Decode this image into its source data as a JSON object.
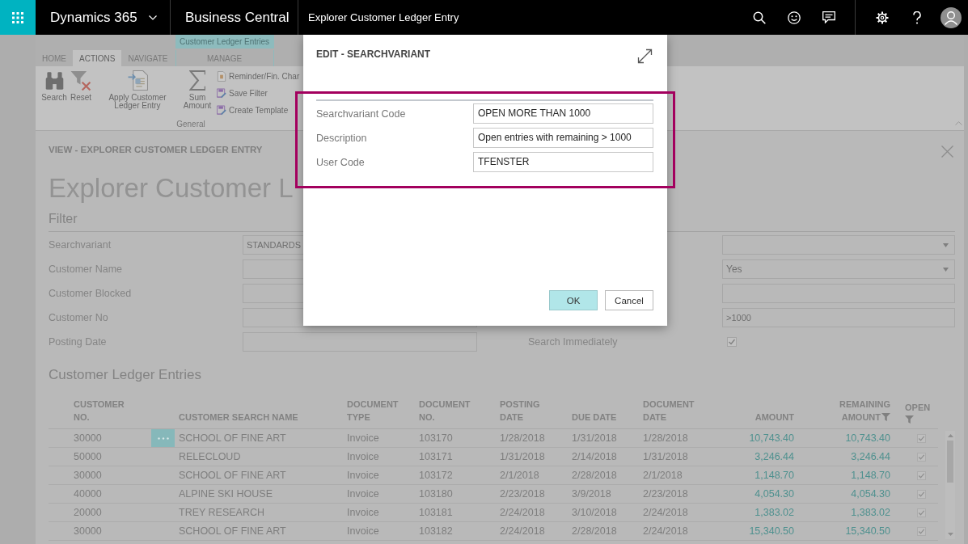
{
  "top_bar": {
    "app_name": "Dynamics 365",
    "product": "Business Central",
    "page_title": "Explorer Customer Ledger Entry"
  },
  "ribbon": {
    "contextual_label": "Customer Ledger Entries",
    "tabs": [
      {
        "label": "HOME",
        "selected": false,
        "contextual": false
      },
      {
        "label": "ACTIONS",
        "selected": true,
        "contextual": false
      },
      {
        "label": "NAVIGATE",
        "selected": false,
        "contextual": false
      },
      {
        "label": "MANAGE",
        "selected": false,
        "contextual": true
      }
    ],
    "actions": [
      {
        "label": "Search",
        "kind": "large"
      },
      {
        "label": "Reset",
        "kind": "large"
      },
      {
        "label": "Apply Customer Ledger Entry",
        "kind": "large"
      },
      {
        "label": "Sum Amount",
        "kind": "large"
      },
      {
        "label": "Reminder/Fin. Char",
        "kind": "small"
      },
      {
        "label": "Save Filter",
        "kind": "small"
      },
      {
        "label": "Create Template",
        "kind": "small"
      }
    ],
    "group_label": "General"
  },
  "page": {
    "caption": "VIEW - EXPLORER CUSTOMER LEDGER ENTRY",
    "title": "Explorer Customer L"
  },
  "filter": {
    "title": "Filter",
    "rows": [
      {
        "label": "Searchvariant",
        "value": "STANDARDS",
        "right_field": {
          "kind": "dropdown"
        }
      },
      {
        "label": "Customer Name",
        "right_field": {
          "kind": "dropdown",
          "value": "Yes"
        }
      },
      {
        "label": "Customer Blocked",
        "right_field": {
          "kind": "text"
        }
      },
      {
        "label": "Customer No",
        "right_field": {
          "kind": "text",
          "value": ">1000"
        }
      },
      {
        "label": "Posting Date",
        "right_field": {
          "kind": "checkbox",
          "label": "Search Immediately",
          "checked": true
        }
      }
    ]
  },
  "entries": {
    "title": "Customer Ledger Entries",
    "columns": [
      {
        "label": "CUSTOMER NO.",
        "kind": "text",
        "filtered": false
      },
      {
        "label": "CUSTOMER SEARCH NAME",
        "kind": "text",
        "filtered": false
      },
      {
        "label": "DOCUMENT TYPE",
        "kind": "text",
        "filtered": false
      },
      {
        "label": "DOCUMENT NO.",
        "kind": "text",
        "filtered": false
      },
      {
        "label": "POSTING DATE",
        "kind": "text",
        "filtered": false
      },
      {
        "label": "DUE DATE",
        "kind": "text",
        "filtered": false
      },
      {
        "label": "DOCUMENT DATE",
        "kind": "text",
        "filtered": false
      },
      {
        "label": "AMOUNT",
        "kind": "amount",
        "filtered": false
      },
      {
        "label": "REMAINING AMOUNT",
        "kind": "amount",
        "filtered": true
      },
      {
        "label": "OPEN",
        "kind": "checkbox",
        "filtered": true
      }
    ],
    "rows": [
      {
        "selected": true,
        "open": true,
        "cells": [
          "30000",
          "SCHOOL OF FINE ART",
          "Invoice",
          "103170",
          "1/28/2018",
          "1/31/2018",
          "1/28/2018",
          "10,743.40",
          "10,743.40"
        ]
      },
      {
        "selected": false,
        "open": true,
        "cells": [
          "50000",
          "RELECLOUD",
          "Invoice",
          "103171",
          "1/31/2018",
          "2/14/2018",
          "1/31/2018",
          "3,246.44",
          "3,246.44"
        ]
      },
      {
        "selected": false,
        "open": true,
        "cells": [
          "30000",
          "SCHOOL OF FINE ART",
          "Invoice",
          "103172",
          "2/1/2018",
          "2/28/2018",
          "2/1/2018",
          "1,148.70",
          "1,148.70"
        ]
      },
      {
        "selected": false,
        "open": true,
        "cells": [
          "40000",
          "ALPINE SKI HOUSE",
          "Invoice",
          "103180",
          "2/23/2018",
          "3/9/2018",
          "2/23/2018",
          "4,054.30",
          "4,054.30"
        ]
      },
      {
        "selected": false,
        "open": true,
        "cells": [
          "20000",
          "TREY RESEARCH",
          "Invoice",
          "103181",
          "2/24/2018",
          "3/10/2018",
          "2/24/2018",
          "1,383.02",
          "1,383.02"
        ]
      },
      {
        "selected": false,
        "open": true,
        "cells": [
          "30000",
          "SCHOOL OF FINE ART",
          "Invoice",
          "103182",
          "2/24/2018",
          "2/28/2018",
          "2/24/2018",
          "15,340.50",
          "15,340.50"
        ]
      }
    ]
  },
  "dialog": {
    "title": "EDIT - SEARCHVARIANT",
    "fields_highlighted": true,
    "fields": [
      {
        "label": "Searchvariant Code",
        "value": "OPEN MORE THAN 1000"
      },
      {
        "label": "Description",
        "value": "Open entries with remaining > 1000"
      },
      {
        "label": "User Code",
        "value": "TFENSTER"
      }
    ],
    "buttons": [
      {
        "label": "OK",
        "kind": "primary"
      },
      {
        "label": "Cancel",
        "kind": "secondary"
      }
    ]
  }
}
